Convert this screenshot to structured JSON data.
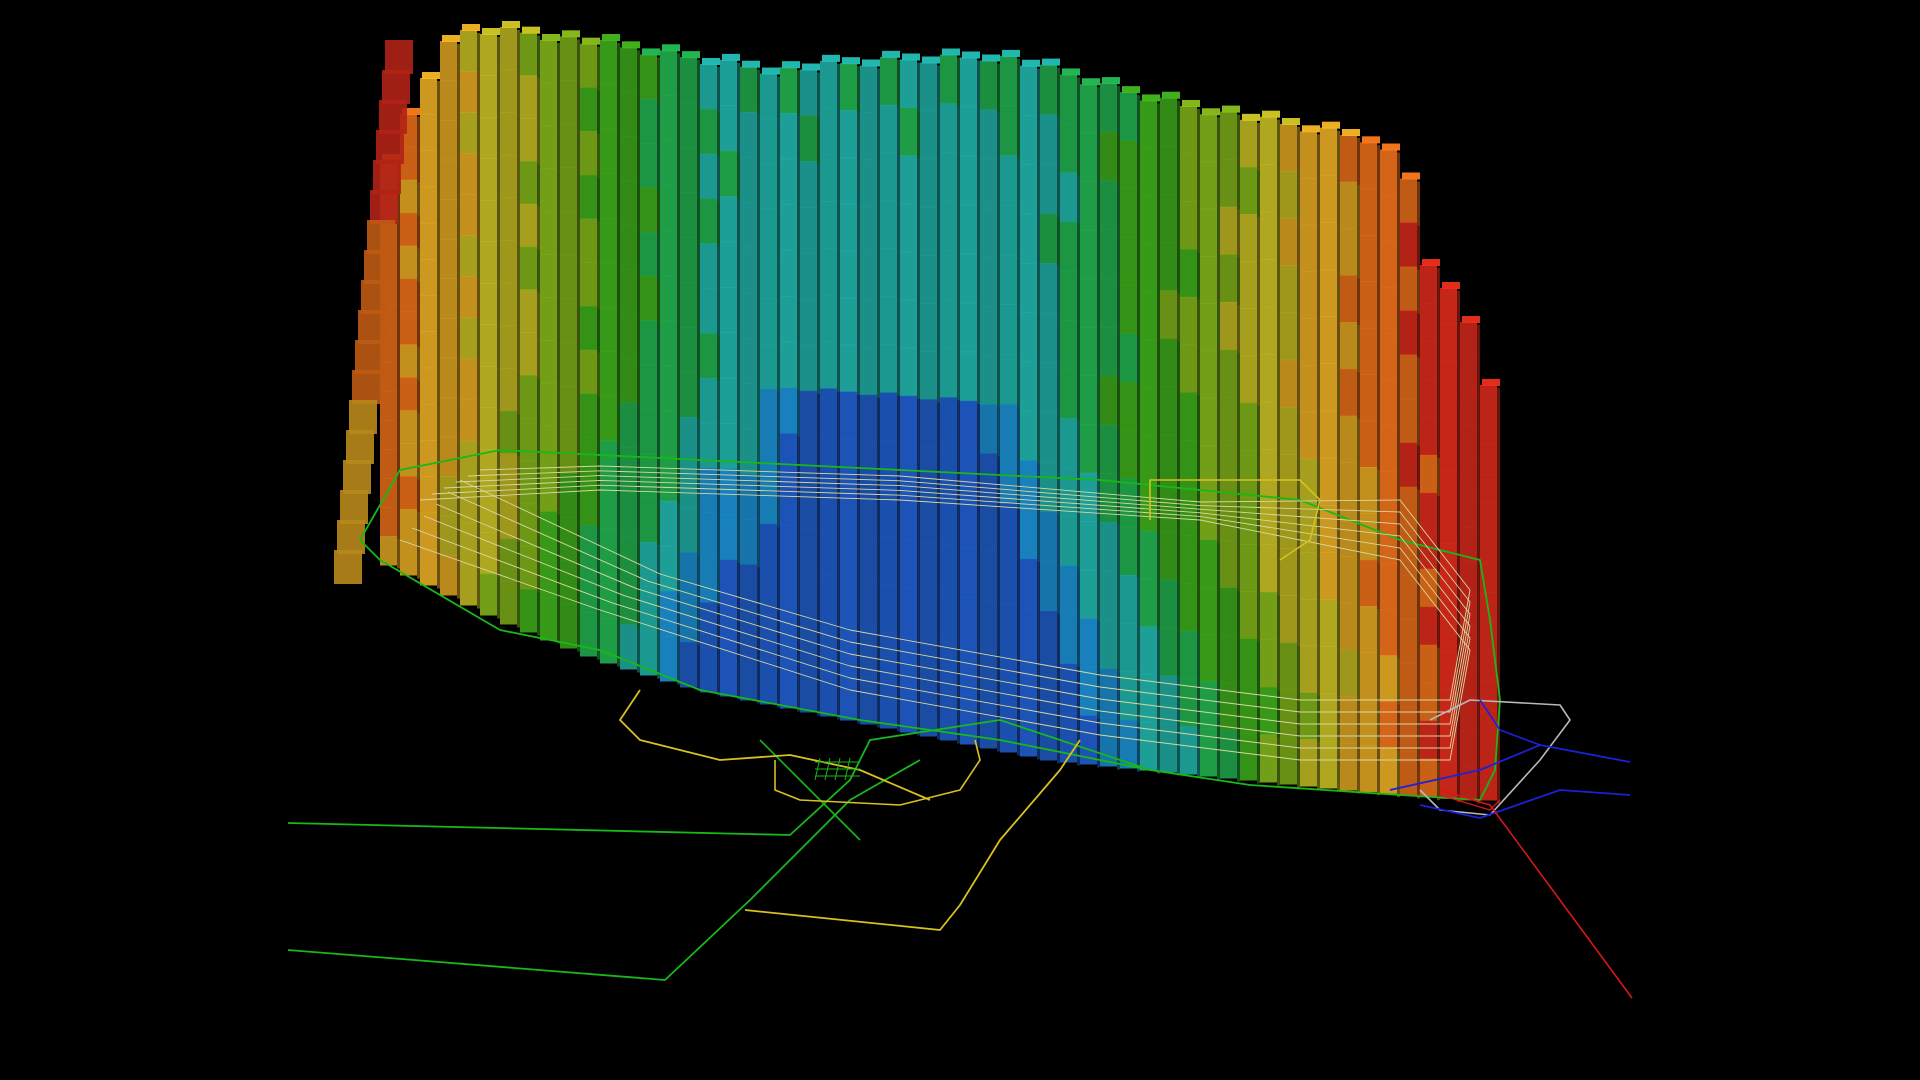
{
  "scene": {
    "background": "#000000",
    "palette": [
      "#d0281a",
      "#e06a18",
      "#d8a020",
      "#b8b020",
      "#78a818",
      "#3aa21a",
      "#20a64a",
      "#1ea8a0",
      "#1a88c8",
      "#1e58c0",
      "#1a2aa8"
    ],
    "block_opacity": 0.9,
    "icons": {
      "block_model": "block-model-icon",
      "wireframe": "wireframe-icon"
    },
    "line_colors": {
      "design_outline": "#18b818",
      "ramp_outline": "#d8c020",
      "boundary": "#1a22d8",
      "outline_gray": "#b8b8b8",
      "drillhole": "#d81818",
      "contour": "#d8d8a0"
    }
  }
}
